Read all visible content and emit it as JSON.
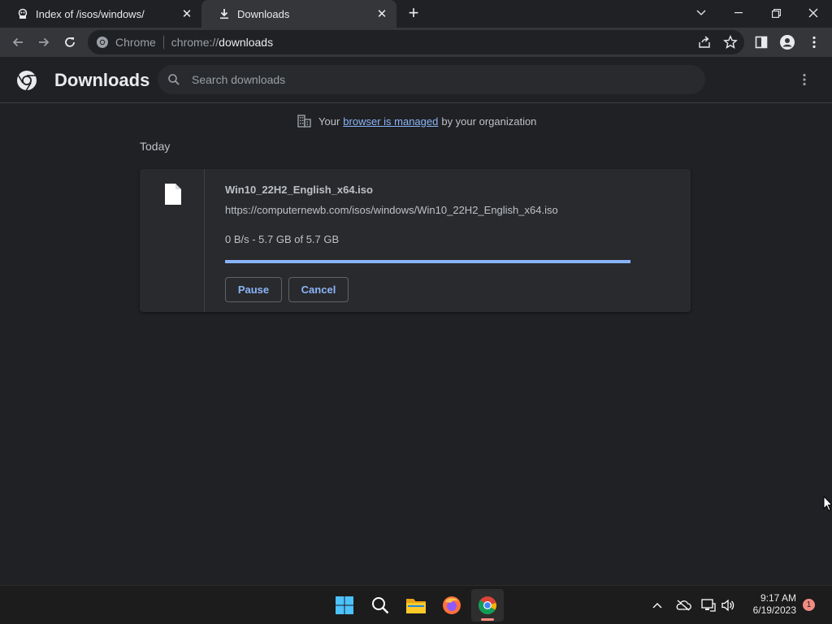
{
  "tabs": [
    {
      "title": "Index of /isos/windows/",
      "icon": "site-icon",
      "close": "✕"
    },
    {
      "title": "Downloads",
      "icon": "download-icon",
      "close": "✕"
    }
  ],
  "new_tab_label": "+",
  "omnibox": {
    "chip": "Chrome",
    "scheme": "chrome://",
    "host": "downloads"
  },
  "page": {
    "title": "Downloads",
    "search_placeholder": "Search downloads"
  },
  "managed": {
    "prefix": "Your",
    "link": "browser is managed",
    "suffix": "by your organization"
  },
  "section_label": "Today",
  "download": {
    "file_name": "Win10_22H2_English_x64.iso",
    "url": "https://computernewb.com/isos/windows/Win10_22H2_English_x64.iso",
    "status": "0 B/s - 5.7 GB of 5.7 GB",
    "progress": 1.0,
    "pause_label": "Pause",
    "cancel_label": "Cancel"
  },
  "taskbar": {
    "time": "9:17 AM",
    "date": "6/19/2023",
    "notification_count": "1",
    "apps": [
      "start-icon",
      "search-icon",
      "file-explorer-icon",
      "firefox-icon",
      "chrome-icon"
    ]
  },
  "colors": {
    "accent": "#8ab4f8",
    "background": "#202124",
    "card": "#292a2d"
  }
}
